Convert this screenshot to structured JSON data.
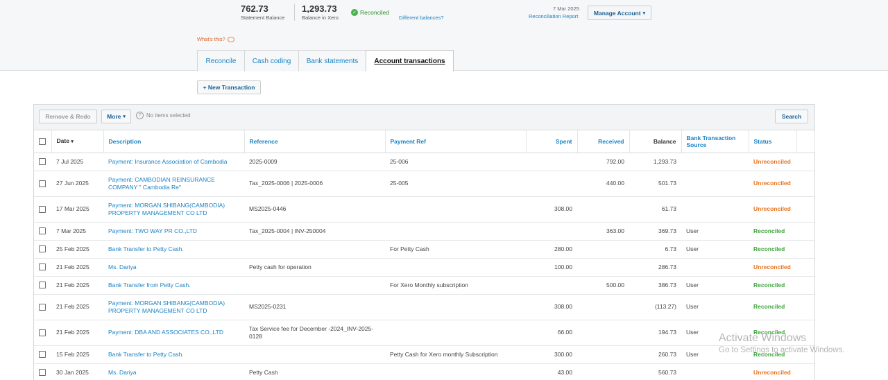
{
  "balances": {
    "statement": {
      "value": "762.73",
      "caption": "Statement Balance"
    },
    "xero": {
      "value": "1,293.73",
      "caption": "Balance in Xero"
    },
    "status": "Reconciled",
    "different_link": "Different balances?"
  },
  "report": {
    "date": "7 Mar 2025",
    "link": "Reconciliation Report"
  },
  "manage_account": "Manage Account",
  "whats_this": "What's this?",
  "tabs": [
    {
      "label": "Reconcile",
      "active": false
    },
    {
      "label": "Cash coding",
      "active": false
    },
    {
      "label": "Bank statements",
      "active": false
    },
    {
      "label": "Account transactions",
      "active": true
    }
  ],
  "new_transaction": "+ New Transaction",
  "toolbar": {
    "remove_redo": "Remove & Redo",
    "more": "More",
    "selection": "No items selected",
    "search": "Search"
  },
  "columns": {
    "date": "Date",
    "description": "Description",
    "reference": "Reference",
    "payment_ref": "Payment Ref",
    "spent": "Spent",
    "received": "Received",
    "balance": "Balance",
    "source": "Bank Transaction Source",
    "status": "Status"
  },
  "rows": [
    {
      "date": "7 Jul 2025",
      "description": "Payment: Insurance Association of Cambodia",
      "reference": "2025-0009",
      "payment_ref": "25-006",
      "spent": "",
      "received": "792.00",
      "balance": "1,293.73",
      "source": "",
      "status": "Unreconciled"
    },
    {
      "date": "27 Jun 2025",
      "description": "Payment: CAMBODIAN REINSURANCE COMPANY \" Cambodia Re\"",
      "reference": "Tax_2025-0006 | 2025-0006",
      "payment_ref": "25-005",
      "spent": "",
      "received": "440.00",
      "balance": "501.73",
      "source": "",
      "status": "Unreconciled"
    },
    {
      "date": "17 Mar 2025",
      "description": "Payment: MORGAN SHIBANG(CAMBODIA) PROPERTY MANAGEMENT CO LTD",
      "reference": "MS2025-0446",
      "payment_ref": "",
      "spent": "308.00",
      "received": "",
      "balance": "61.73",
      "source": "",
      "status": "Unreconciled"
    },
    {
      "date": "7 Mar 2025",
      "description": "Payment: TWO WAY PR CO.,LTD",
      "reference": "Tax_2025-0004 | INV-250004",
      "payment_ref": "",
      "spent": "",
      "received": "363.00",
      "balance": "369.73",
      "source": "User",
      "status": "Reconciled"
    },
    {
      "date": "25 Feb 2025",
      "description": "Bank Transfer to Petty Cash.",
      "reference": "",
      "payment_ref": "For Petty Cash",
      "spent": "280.00",
      "received": "",
      "balance": "6.73",
      "source": "User",
      "status": "Reconciled"
    },
    {
      "date": "21 Feb 2025",
      "description": "Ms. Dariya",
      "reference": "Petty cash for operation",
      "payment_ref": "",
      "spent": "100.00",
      "received": "",
      "balance": "286.73",
      "source": "",
      "status": "Unreconciled"
    },
    {
      "date": "21 Feb 2025",
      "description": "Bank Transfer from Petty Cash.",
      "reference": "",
      "payment_ref": "For Xero Monthly subscription",
      "spent": "",
      "received": "500.00",
      "balance": "386.73",
      "source": "User",
      "status": "Reconciled"
    },
    {
      "date": "21 Feb 2025",
      "description": "Payment: MORGAN SHIBANG(CAMBODIA) PROPERTY MANAGEMENT CO LTD",
      "reference": "MS2025-0231",
      "payment_ref": "",
      "spent": "308.00",
      "received": "",
      "balance": "(113.27)",
      "source": "User",
      "status": "Reconciled"
    },
    {
      "date": "21 Feb 2025",
      "description": "Payment: DBA AND ASSOCIATES CO.,LTD",
      "reference": "Tax Service fee for December -2024_INV-2025-0128",
      "payment_ref": "",
      "spent": "66.00",
      "received": "",
      "balance": "194.73",
      "source": "User",
      "status": "Reconciled"
    },
    {
      "date": "15 Feb 2025",
      "description": "Bank Transfer to Petty Cash.",
      "reference": "",
      "payment_ref": "Petty Cash for Xero monthly Subscription",
      "spent": "300.00",
      "received": "",
      "balance": "260.73",
      "source": "User",
      "status": "Reconciled"
    },
    {
      "date": "30 Jan 2025",
      "description": "Ms. Dariya",
      "reference": "Petty Cash",
      "payment_ref": "",
      "spent": "43.00",
      "received": "",
      "balance": "560.73",
      "source": "",
      "status": "Unreconciled"
    }
  ],
  "watermark": {
    "line1": "Activate Windows",
    "line2": "Go to Settings to activate Windows."
  }
}
